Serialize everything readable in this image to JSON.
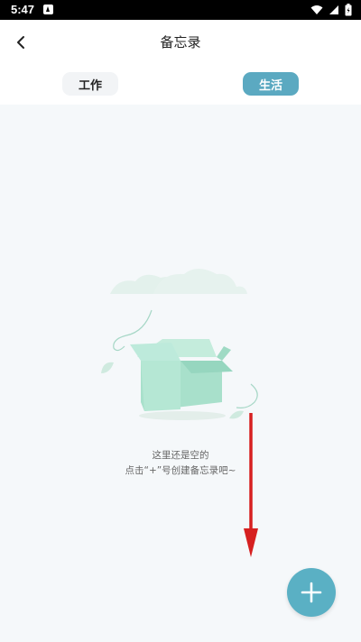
{
  "status_bar": {
    "time": "5:47",
    "icons": [
      "app-notification-icon",
      "wifi-icon",
      "signal-icon",
      "battery-icon"
    ]
  },
  "header": {
    "title": "备忘录",
    "back_icon": "chevron-left-icon"
  },
  "tabs": [
    {
      "label": "工作",
      "selected": false
    },
    {
      "label": "生活",
      "selected": true
    }
  ],
  "empty_state": {
    "line1": "这里还是空的",
    "line2": "点击“+”号创建备忘录吧~",
    "illustration": "empty-box-illustration"
  },
  "annotation": {
    "icon": "red-down-arrow",
    "color": "#d62020"
  },
  "fab": {
    "icon": "plus-icon"
  },
  "colors": {
    "accent": "#5ba9c1",
    "fab": "#5ab0c4",
    "tab_inactive_bg": "#f2f4f6",
    "content_bg": "#f5f8fa",
    "box": "#a8e0cb"
  }
}
